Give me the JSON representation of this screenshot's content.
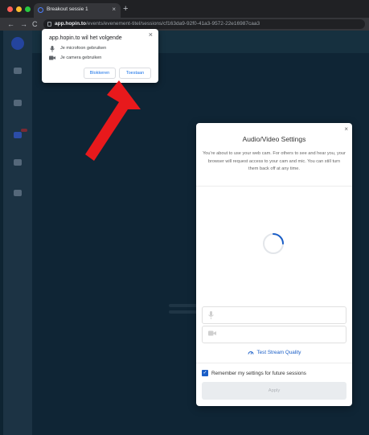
{
  "browser": {
    "tab_title": "Breakout sessie 1",
    "tab_close": "×",
    "new_tab": "+",
    "back": "←",
    "forward": "→",
    "reload": "C",
    "url_host": "app.hopin.to",
    "url_path": "/events/evenement-titel/sessions/cf163da9-92f0-41a3-9572-22e16987caa3"
  },
  "permission": {
    "title": "app.hopin.to wil het volgende",
    "close": "×",
    "items": [
      {
        "icon": "microphone-icon",
        "label": "Je microfoon gebruiken"
      },
      {
        "icon": "camera-icon",
        "label": "Je camera gebruiken"
      }
    ],
    "block_label": "Blokkeren",
    "allow_label": "Toestaan"
  },
  "settings_modal": {
    "close": "×",
    "title": "Audio/Video Settings",
    "description": "You're about to use your web cam. For others to see and hear you, your browser will request access to your cam and mic. You can still turn them back off at any time.",
    "test_stream_label": "Test Stream Quality",
    "remember_label": "Remember my settings for future sessions",
    "remember_checked": true,
    "apply_label": "Apply"
  },
  "colors": {
    "accent": "#1a5ec7",
    "arrow": "#e8191c",
    "backdrop": "#0e2432"
  }
}
